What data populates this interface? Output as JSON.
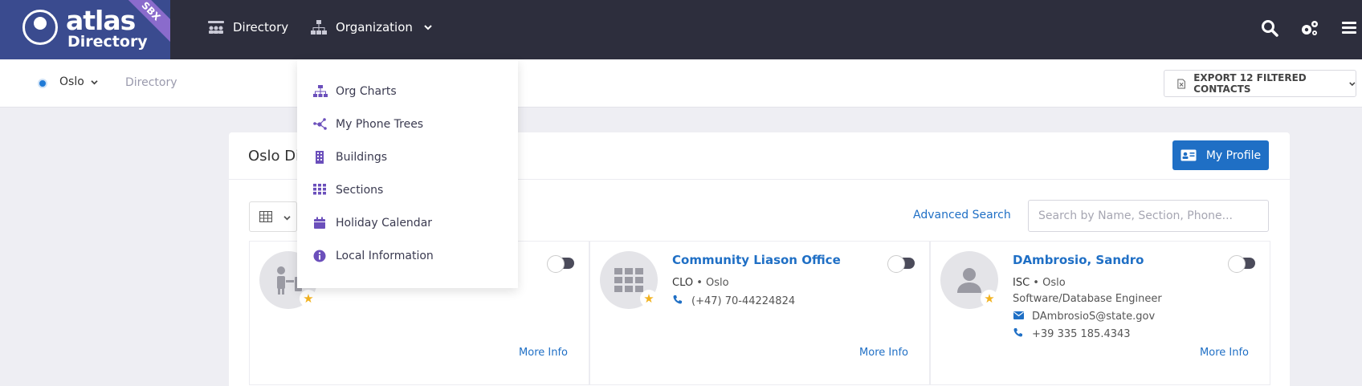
{
  "topbar": {
    "logo_title": "atlas",
    "logo_sub": "Directory",
    "badge": "SBX",
    "nav": [
      {
        "label": "Directory",
        "icon": "people-group-icon"
      },
      {
        "label": "Organization",
        "icon": "org-chart-icon"
      }
    ],
    "right_icons": [
      "search-icon",
      "gears-icon",
      "menu-icon"
    ]
  },
  "subbar": {
    "location": "Oslo",
    "breadcrumb": "Directory",
    "export_label": "EXPORT 12 FILTERED CONTACTS"
  },
  "panel": {
    "title": "Oslo Di",
    "my_profile_label": "My Profile",
    "advanced_search_label": "Advanced Search",
    "search_placeholder": "Search by Name, Section, Phone..."
  },
  "cards": [
    {
      "name": "",
      "more_info": "More Info"
    },
    {
      "name": "Community Liason Office",
      "section": "CLO",
      "location": "Oslo",
      "phone": "(+47) 70-44224824",
      "more_info": "More Info"
    },
    {
      "name": "DAmbrosio, Sandro",
      "section": "ISC",
      "location": "Oslo",
      "title": "Software/Database Engineer",
      "email": "DAmbrosioS@state.gov",
      "phone": "+39 335 185.4343",
      "more_info": "More Info"
    }
  ],
  "dropdown": {
    "items": [
      {
        "label": "Org Charts",
        "icon": "org-chart-icon"
      },
      {
        "label": "My Phone Trees",
        "icon": "nodes-icon"
      },
      {
        "label": "Buildings",
        "icon": "building-icon"
      },
      {
        "label": "Sections",
        "icon": "grid-icon"
      },
      {
        "label": "Holiday Calendar",
        "icon": "calendar-icon"
      },
      {
        "label": "Local Information",
        "icon": "info-icon"
      }
    ]
  },
  "colors": {
    "topbar": "#2d2e3d",
    "logo_bg": "#3a4b8f",
    "accent": "#1f6fc5",
    "dropdown_icon": "#6b4fbb",
    "star": "#f2b21f"
  }
}
